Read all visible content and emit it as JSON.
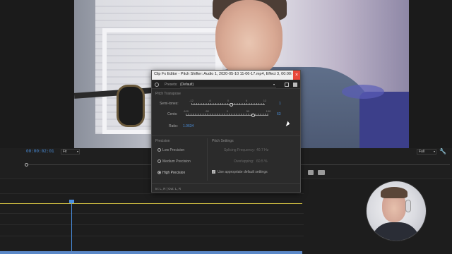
{
  "program_monitor": {
    "timecode": "00:00:02:01",
    "fit_select": "Fit",
    "full_select": "Full"
  },
  "dialog": {
    "title": "Clip Fx Editor - Pitch Shifter: Audio 1, 2020-05-10 11-06-17.mp4, Effect 3, 00:00:00...",
    "close_label": "×",
    "presets_label": "Presets:",
    "preset_value": "(Default)",
    "pitch_transpose": {
      "section_label": "Pitch Transpose",
      "semitones": {
        "label": "Semi-tones:",
        "value": "1",
        "ticks": [
          "-12",
          "-6",
          "0",
          "6",
          "12"
        ],
        "level": 1,
        "range": [
          -12,
          12
        ]
      },
      "cents": {
        "label": "Cents:",
        "value": "63",
        "ticks": [
          "-100",
          "-50",
          "0",
          "50",
          "100"
        ],
        "level": 63,
        "range": [
          -100,
          100
        ]
      },
      "ratio": {
        "label": "Ratio:",
        "value": "1.0634"
      }
    },
    "precision": {
      "section_label": "Precision",
      "options": [
        "Low Precision",
        "Medium Precision",
        "High Precision"
      ],
      "selected": "High Precision"
    },
    "pitch_settings": {
      "section_label": "Pitch Settings",
      "splicing_label": "Splicing Frequency:",
      "splicing_value": "40.7 Hz",
      "overlapping_label": "Overlapping:",
      "overlapping_value": "60.5 %",
      "use_default_label": "Use appropriate default settings",
      "use_default_checked": true
    },
    "io_label": "In: L, R | Out: L, R"
  },
  "colors": {
    "accent": "#4a8fdc",
    "timeline_yellow": "#c8b640",
    "close_red": "#e8473a"
  },
  "icons": [
    "power-icon",
    "save-preset-icon",
    "delete-preset-icon",
    "wrench-icon",
    "close-icon",
    "mouse-cursor-icon"
  ]
}
